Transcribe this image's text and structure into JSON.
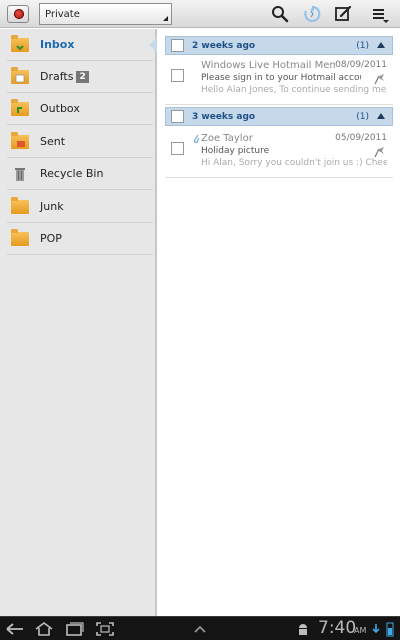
{
  "topbar": {
    "account": "Private",
    "icons": [
      "app-icon",
      "search-icon",
      "sync-icon",
      "compose-icon",
      "menu-icon"
    ]
  },
  "folders": [
    {
      "label": "Inbox",
      "icon": "inbox-folder-icon",
      "selected": true
    },
    {
      "label": "Drafts",
      "icon": "drafts-folder-icon",
      "badge": "2"
    },
    {
      "label": "Outbox",
      "icon": "outbox-folder-icon"
    },
    {
      "label": "Sent",
      "icon": "sent-folder-icon"
    },
    {
      "label": "Recycle Bin",
      "icon": "recycle-bin-icon"
    },
    {
      "label": "Junk",
      "icon": "junk-folder-icon"
    },
    {
      "label": "POP",
      "icon": "pop-folder-icon"
    }
  ],
  "groups": [
    {
      "title": "2 weeks ago",
      "count": "(1)",
      "messages": [
        {
          "sender": "Windows Live Hotmail Mem...",
          "date": "08/09/2011",
          "subject": "Please sign in to your Hotmail account",
          "preview": "Hello Alan Jones, To continue sending me...",
          "attachment": false
        }
      ]
    },
    {
      "title": "3 weeks ago",
      "count": "(1)",
      "messages": [
        {
          "sender": "Zoe Taylor",
          "date": "05/09/2011",
          "subject": "Holiday picture",
          "preview": "Hi Alan, Sorry you couldn't join us :) Cheer...",
          "attachment": true
        }
      ]
    }
  ],
  "status": {
    "time": "7:40",
    "ampm": "AM"
  },
  "colors": {
    "accent": "#1f6ab3",
    "group_header": "#c5d9ea",
    "sysbar": "#141414"
  }
}
